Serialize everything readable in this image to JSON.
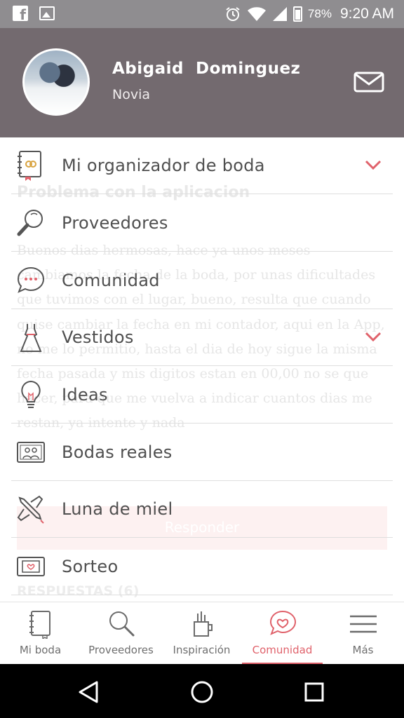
{
  "status_bar": {
    "battery": "78%",
    "time": "9:20 AM",
    "icons": [
      "facebook-icon",
      "image-icon",
      "alarm-icon",
      "wifi-icon",
      "signal-icon",
      "battery-icon"
    ]
  },
  "header": {
    "first_name": "Abigaid",
    "last_name": "Dominguez",
    "role": "Novia",
    "icons": [
      "avatar-photo",
      "mail-icon"
    ]
  },
  "background_page": {
    "title": "Problema con la aplicacion",
    "body_lines": [
      "Buenos dias hermosas, hace ya unos meses",
      "cambiamos la fecha de la boda, por unas dificultades",
      "que tuvimos con el lugar, bueno, resulta que cuando",
      "quise cambiar la fecha en mi contador, aqui en la App,",
      "no me lo permitio, hasta el dia de hoy sigue la misma",
      "fecha pasada y mis digitos estan en 00,00 no se que",
      "hacer, para que me vuelva a indicar cuantos dias me",
      "restan, ya intente y nada"
    ],
    "reply_button": "Responder",
    "answers_heading": "RESPUESTAS (6)"
  },
  "menu": {
    "items": [
      {
        "label": "Mi organizador de boda",
        "icon": "planner-book-icon",
        "expandable": true
      },
      {
        "label": "Proveedores",
        "icon": "magnifier-icon",
        "expandable": false
      },
      {
        "label": "Comunidad",
        "icon": "chat-bubble-icon",
        "expandable": false
      },
      {
        "label": "Vestidos",
        "icon": "dress-icon",
        "expandable": true
      },
      {
        "label": "Ideas",
        "icon": "lightbulb-icon",
        "expandable": false
      },
      {
        "label": "Bodas reales",
        "icon": "couple-photo-icon",
        "expandable": false
      },
      {
        "label": "Luna de miel",
        "icon": "plane-icon",
        "expandable": false
      },
      {
        "label": "Sorteo",
        "icon": "ticket-icon",
        "expandable": false
      }
    ]
  },
  "bottom_nav": {
    "tabs": [
      {
        "label": "Mi boda",
        "icon": "notebook-icon"
      },
      {
        "label": "Proveedores",
        "icon": "search-icon"
      },
      {
        "label": "Inspiración",
        "icon": "pencil-cup-icon"
      },
      {
        "label": "Comunidad",
        "icon": "heart-chat-icon"
      },
      {
        "label": "Más",
        "icon": "hamburger-icon"
      }
    ],
    "active_tab": "Comunidad"
  },
  "colors": {
    "header_bg": "#736a6f",
    "status_bar_bg": "#8f8d90",
    "accent": "#e0626b",
    "menu_text": "#4f4f4f"
  }
}
